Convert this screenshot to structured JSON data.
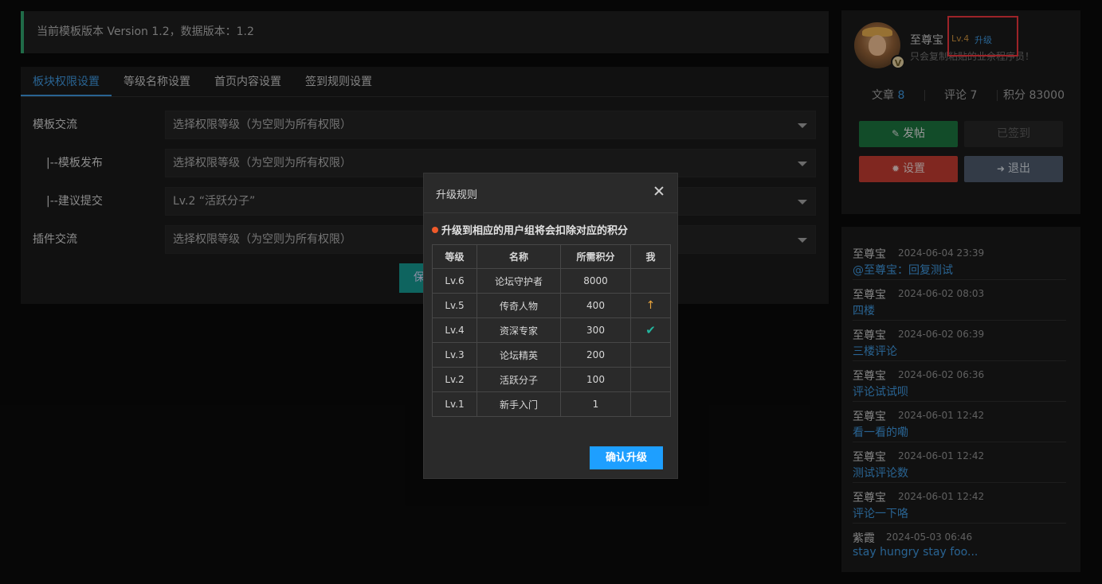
{
  "notice": {
    "text": "当前模板版本 Version 1.2，数据版本：1.2"
  },
  "tabs": [
    {
      "label": "板块权限设置"
    },
    {
      "label": "等级名称设置"
    },
    {
      "label": "首页内容设置"
    },
    {
      "label": "签到规则设置"
    }
  ],
  "form": {
    "rows": [
      {
        "label": "模板交流",
        "value": "选择权限等级（为空则为所有权限）"
      },
      {
        "label": "|--模板发布",
        "value": "选择权限等级（为空则为所有权限）"
      },
      {
        "label": "|--建议提交",
        "value": "Lv.2 “活跃分子”"
      },
      {
        "label": "插件交流",
        "value": "选择权限等级（为空则为所有权限）"
      }
    ],
    "save_label": "保存"
  },
  "profile": {
    "name": "至尊宝",
    "level": "Lv.4",
    "upgrade_label": "升级",
    "description": "只会复制粘贴的业余程序员！",
    "vip_badge": "V",
    "stats": {
      "articles_label": "文章",
      "articles": "8",
      "comments_label": "评论",
      "comments": "7",
      "points_label": "积分",
      "points": "83000"
    },
    "buttons": {
      "post": "发帖",
      "signed": "已签到",
      "settings": "设置",
      "logout": "退出"
    }
  },
  "comments": [
    {
      "author": "至尊宝",
      "time": "2024-06-04 23:39",
      "text": "@至尊宝：回复测试"
    },
    {
      "author": "至尊宝",
      "time": "2024-06-02 08:03",
      "text": "四楼"
    },
    {
      "author": "至尊宝",
      "time": "2024-06-02 06:39",
      "text": "三楼评论"
    },
    {
      "author": "至尊宝",
      "time": "2024-06-02 06:36",
      "text": "评论试试呗"
    },
    {
      "author": "至尊宝",
      "time": "2024-06-01 12:42",
      "text": "看一看的嘞"
    },
    {
      "author": "至尊宝",
      "time": "2024-06-01 12:42",
      "text": "测试评论数"
    },
    {
      "author": "至尊宝",
      "time": "2024-06-01 12:42",
      "text": "评论一下咯"
    },
    {
      "author": "紫霞",
      "time": "2024-05-03 06:46",
      "text": "stay hungry stay foo..."
    }
  ],
  "modal": {
    "title": "升级规则",
    "note": "升级到相应的用户组将会扣除对应的积分",
    "headers": [
      "等级",
      "名称",
      "所需积分",
      "我"
    ],
    "rows": [
      {
        "level": "Lv.6",
        "name": "论坛守护者",
        "points": "8000",
        "mark": ""
      },
      {
        "level": "Lv.5",
        "name": "传奇人物",
        "points": "400",
        "mark": "↑"
      },
      {
        "level": "Lv.4",
        "name": "资深专家",
        "points": "300",
        "mark": "✔"
      },
      {
        "level": "Lv.3",
        "name": "论坛精英",
        "points": "200",
        "mark": ""
      },
      {
        "level": "Lv.2",
        "name": "活跃分子",
        "points": "100",
        "mark": ""
      },
      {
        "level": "Lv.1",
        "name": "新手入门",
        "points": "1",
        "mark": ""
      }
    ],
    "confirm_label": "确认升级"
  },
  "colors": {
    "accent": "#3b8fd1",
    "confirm": "#1e9fff",
    "post_button": "#1b6e3c",
    "settings_button": "#b8392f",
    "logout_button": "#4a5566",
    "highlight": "#e0333a"
  },
  "icons": {
    "post": "edit-icon",
    "settings": "gear-icon",
    "logout": "logout-icon",
    "close": "close-icon",
    "note": "dot-icon",
    "upgrade_target": "arrow-up-icon",
    "current_level": "check-icon"
  }
}
